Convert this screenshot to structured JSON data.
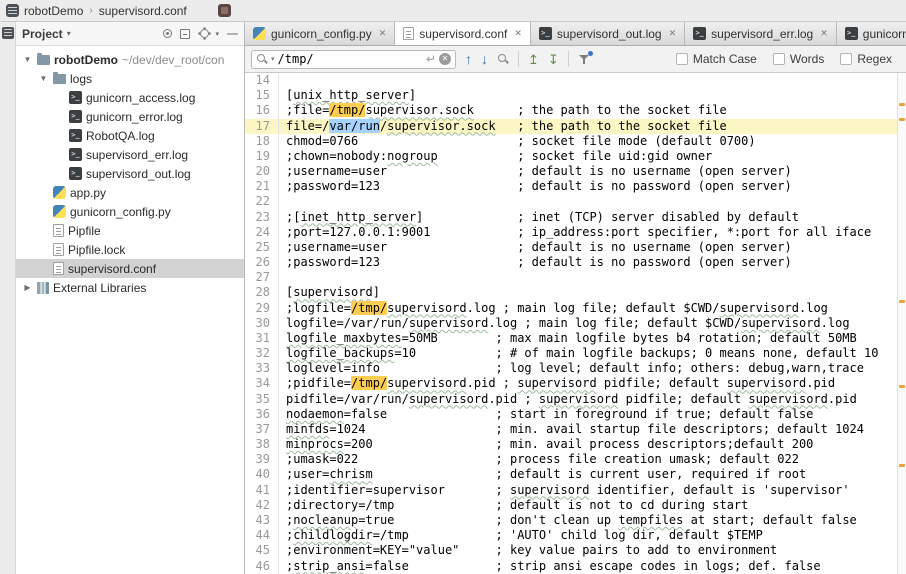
{
  "colors": {
    "match_bg": "#ffcd50",
    "selection_bg": "#a6d2ff",
    "caret_row_bg": "#fcf6c5",
    "accent_blue": "#3a76c4",
    "stripe_mark": "#e8a33d"
  },
  "icons": {
    "close": "✕",
    "expanded": "▼",
    "collapsed": "▶",
    "breadcrumb_sep": "›",
    "header_caret": "▾",
    "enter": "↵",
    "up_arrow": "↑",
    "down_arrow": "↓",
    "occ_up": "↥",
    "occ_down": "↧",
    "hide": "—"
  },
  "navbar": {
    "project": "robotDemo",
    "file": "supervisord.conf"
  },
  "project_panel": {
    "title": "Project",
    "tree": [
      {
        "label": "robotDemo",
        "hint": "~/dev/dev_root/con",
        "icon": "folder",
        "depth": 0,
        "chev": "exp",
        "bold": true
      },
      {
        "label": "logs",
        "icon": "folder",
        "depth": 1,
        "chev": "exp"
      },
      {
        "label": "gunicorn_access.log",
        "icon": "console",
        "depth": 2
      },
      {
        "label": "gunicorn_error.log",
        "icon": "console",
        "depth": 2
      },
      {
        "label": "RobotQA.log",
        "icon": "console",
        "depth": 2
      },
      {
        "label": "supervisord_err.log",
        "icon": "console",
        "depth": 2
      },
      {
        "label": "supervisord_out.log",
        "icon": "console",
        "depth": 2
      },
      {
        "label": "app.py",
        "icon": "python",
        "depth": 1
      },
      {
        "label": "gunicorn_config.py",
        "icon": "python",
        "depth": 1
      },
      {
        "label": "Pipfile",
        "icon": "text",
        "depth": 1
      },
      {
        "label": "Pipfile.lock",
        "icon": "text",
        "depth": 1
      },
      {
        "label": "supervisord.conf",
        "icon": "text",
        "depth": 1,
        "selected": true
      },
      {
        "label": "External Libraries",
        "icon": "lib",
        "depth": 0,
        "chev": "col"
      }
    ]
  },
  "tabs": {
    "items": [
      {
        "label": "gunicorn_config.py",
        "icon": "python"
      },
      {
        "label": "supervisord.conf",
        "icon": "text",
        "active": true
      },
      {
        "label": "supervisord_out.log",
        "icon": "console"
      },
      {
        "label": "supervisord_err.log",
        "icon": "console"
      },
      {
        "label": "gunicorn_",
        "icon": "console"
      }
    ]
  },
  "find": {
    "query": "/tmp/",
    "options": [
      {
        "label": "Match Case",
        "checked": false
      },
      {
        "label": "Words",
        "checked": false
      },
      {
        "label": "Regex",
        "checked": false
      }
    ]
  },
  "editor": {
    "current_line": 17,
    "stripe_marks": [
      0.06,
      0.09,
      0.453,
      0.623,
      0.78
    ],
    "lines": [
      {
        "no": 14,
        "segs": []
      },
      {
        "no": 15,
        "segs": [
          {
            "t": "["
          },
          {
            "t": "unix_http_server",
            "s": "u"
          },
          {
            "t": "]"
          }
        ]
      },
      {
        "no": 16,
        "segs": [
          {
            "t": ";file="
          },
          {
            "t": "/tmp/",
            "s": "m"
          },
          {
            "t": "supervisor.sock",
            "s": "u"
          },
          {
            "t": "      ; the path to the socket file"
          }
        ]
      },
      {
        "no": 17,
        "segs": [
          {
            "t": "file=/"
          },
          {
            "t": "var/run",
            "s": "sel"
          },
          {
            "t": "/"
          },
          {
            "t": "supervisor.sock",
            "s": "u"
          },
          {
            "t": "   ; the path to the socket file"
          }
        ]
      },
      {
        "no": 18,
        "segs": [
          {
            "t": "chmod=0766                      ; socket file mode (default 0700)"
          }
        ]
      },
      {
        "no": 19,
        "segs": [
          {
            "t": ";chown=nobody:"
          },
          {
            "t": "nogroup",
            "s": "u"
          },
          {
            "t": "           ; socket file uid:gid owner"
          }
        ]
      },
      {
        "no": 20,
        "segs": [
          {
            "t": ";username=user                  ; default is no username (open server)"
          }
        ]
      },
      {
        "no": 21,
        "segs": [
          {
            "t": ";password=123                   ; default is no password (open server)"
          }
        ]
      },
      {
        "no": 22,
        "segs": []
      },
      {
        "no": 23,
        "segs": [
          {
            "t": ";["
          },
          {
            "t": "inet_http_server",
            "s": "u"
          },
          {
            "t": "]             ; inet (TCP) server disabled by default"
          }
        ]
      },
      {
        "no": 24,
        "segs": [
          {
            "t": ";port=127.0.0.1:9001            ; ip_address:port specifier, *:port for all iface"
          }
        ]
      },
      {
        "no": 25,
        "segs": [
          {
            "t": ";username=user                  ; default is no username (open server)"
          }
        ]
      },
      {
        "no": 26,
        "segs": [
          {
            "t": ";password=123                   ; default is no password (open server)"
          }
        ]
      },
      {
        "no": 27,
        "segs": []
      },
      {
        "no": 28,
        "segs": [
          {
            "t": "["
          },
          {
            "t": "supervisord",
            "s": "u"
          },
          {
            "t": "]"
          }
        ]
      },
      {
        "no": 29,
        "segs": [
          {
            "t": ";logfile="
          },
          {
            "t": "/tmp/",
            "s": "m"
          },
          {
            "t": "supervisord",
            "s": "u"
          },
          {
            "t": ".log ; main log file; default $CWD/"
          },
          {
            "t": "supervisord",
            "s": "u"
          },
          {
            "t": ".log"
          }
        ]
      },
      {
        "no": 30,
        "segs": [
          {
            "t": "logfile=/var/run/"
          },
          {
            "t": "supervisord",
            "s": "u"
          },
          {
            "t": ".log ; main log file; default $CWD/"
          },
          {
            "t": "supervisord",
            "s": "u"
          },
          {
            "t": ".log"
          }
        ]
      },
      {
        "no": 31,
        "segs": [
          {
            "t": "logfile_maxbytes",
            "s": "u"
          },
          {
            "t": "=50MB        ; max main logfile bytes b4 rotation; default 50MB"
          }
        ]
      },
      {
        "no": 32,
        "segs": [
          {
            "t": "logfile_backups",
            "s": "u"
          },
          {
            "t": "=10           ; # of main logfile backups; 0 means none, default 10"
          }
        ]
      },
      {
        "no": 33,
        "segs": [
          {
            "t": "loglevel=info                ; log level; default info; others: debug,warn,trace"
          }
        ]
      },
      {
        "no": 34,
        "segs": [
          {
            "t": ";pidfile="
          },
          {
            "t": "/tmp/",
            "s": "m"
          },
          {
            "t": "supervisord",
            "s": "u"
          },
          {
            "t": ".pid ; "
          },
          {
            "t": "supervisord",
            "s": "u"
          },
          {
            "t": " pidfile; default "
          },
          {
            "t": "supervisord",
            "s": "u"
          },
          {
            "t": ".pid"
          }
        ]
      },
      {
        "no": 35,
        "segs": [
          {
            "t": "pidfile=/var/run/"
          },
          {
            "t": "supervisord",
            "s": "u"
          },
          {
            "t": ".pid ; "
          },
          {
            "t": "supervisord",
            "s": "u"
          },
          {
            "t": " pidfile; default "
          },
          {
            "t": "supervisord",
            "s": "u"
          },
          {
            "t": ".pid"
          }
        ]
      },
      {
        "no": 36,
        "segs": [
          {
            "t": "nodaemon",
            "s": "u"
          },
          {
            "t": "=false               ; start in foreground if true; default false"
          }
        ]
      },
      {
        "no": 37,
        "segs": [
          {
            "t": "minfds",
            "s": "u"
          },
          {
            "t": "=1024                  ; min. avail startup file descriptors; default 1024"
          }
        ]
      },
      {
        "no": 38,
        "segs": [
          {
            "t": "minprocs",
            "s": "u"
          },
          {
            "t": "=200                 ; min. avail process descriptors;default 200"
          }
        ]
      },
      {
        "no": 39,
        "segs": [
          {
            "t": ";umask=022                   ; process file creation umask; default 022"
          }
        ]
      },
      {
        "no": 40,
        "segs": [
          {
            "t": ";user="
          },
          {
            "t": "chrism",
            "s": "u"
          },
          {
            "t": "                 ; default is current user, required if root"
          }
        ]
      },
      {
        "no": 41,
        "segs": [
          {
            "t": ";identifier=supervisor       ; "
          },
          {
            "t": "supervisord",
            "s": "u"
          },
          {
            "t": " identifier, default is 'supervisor'"
          }
        ]
      },
      {
        "no": 42,
        "segs": [
          {
            "t": ";directory=/tmp              ; default is not to cd during start"
          }
        ]
      },
      {
        "no": 43,
        "segs": [
          {
            "t": ";"
          },
          {
            "t": "nocleanup",
            "s": "u"
          },
          {
            "t": "=true              ; don't clean up "
          },
          {
            "t": "tempfiles",
            "s": "u"
          },
          {
            "t": " at start; default false"
          }
        ]
      },
      {
        "no": 44,
        "segs": [
          {
            "t": ";"
          },
          {
            "t": "childlogdir",
            "s": "u"
          },
          {
            "t": "=/tmp            ; 'AUTO' child log dir, default $TEMP"
          }
        ]
      },
      {
        "no": 45,
        "segs": [
          {
            "t": ";environment=KEY=\"value\"     ; key value pairs to add to environment"
          }
        ]
      },
      {
        "no": 46,
        "segs": [
          {
            "t": ";"
          },
          {
            "t": "strip_ansi",
            "s": "u"
          },
          {
            "t": "=false            ; strip ansi escape codes in logs; def. false"
          }
        ]
      }
    ]
  }
}
